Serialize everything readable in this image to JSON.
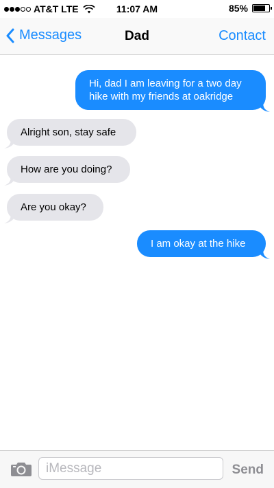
{
  "status_bar": {
    "carrier": "AT&T LTE",
    "time": "11:07 AM",
    "battery_percent": "85%",
    "battery_level": 0.85,
    "signal_bars_filled": 3,
    "signal_bars_total": 5
  },
  "nav": {
    "back_label": "Messages",
    "title": "Dad",
    "contact_label": "Contact"
  },
  "messages": [
    {
      "direction": "outgoing",
      "text": "Hi, dad I am leaving for a two day hike with my friends at oakridge"
    },
    {
      "direction": "incoming",
      "text": "Alright son, stay safe"
    },
    {
      "direction": "incoming",
      "text": "How are you doing?"
    },
    {
      "direction": "incoming",
      "text": "Are you okay?"
    },
    {
      "direction": "outgoing",
      "text": "I am okay at the hike"
    }
  ],
  "input_bar": {
    "placeholder": "iMessage",
    "send_label": "Send"
  },
  "colors": {
    "accent": "#1a8cff",
    "incoming_bubble": "#e5e5ea",
    "outgoing_bubble": "#1a8cff"
  },
  "icons": {
    "back": "chevron-left-icon",
    "camera": "camera-icon",
    "wifi": "wifi-icon",
    "battery": "battery-icon"
  }
}
